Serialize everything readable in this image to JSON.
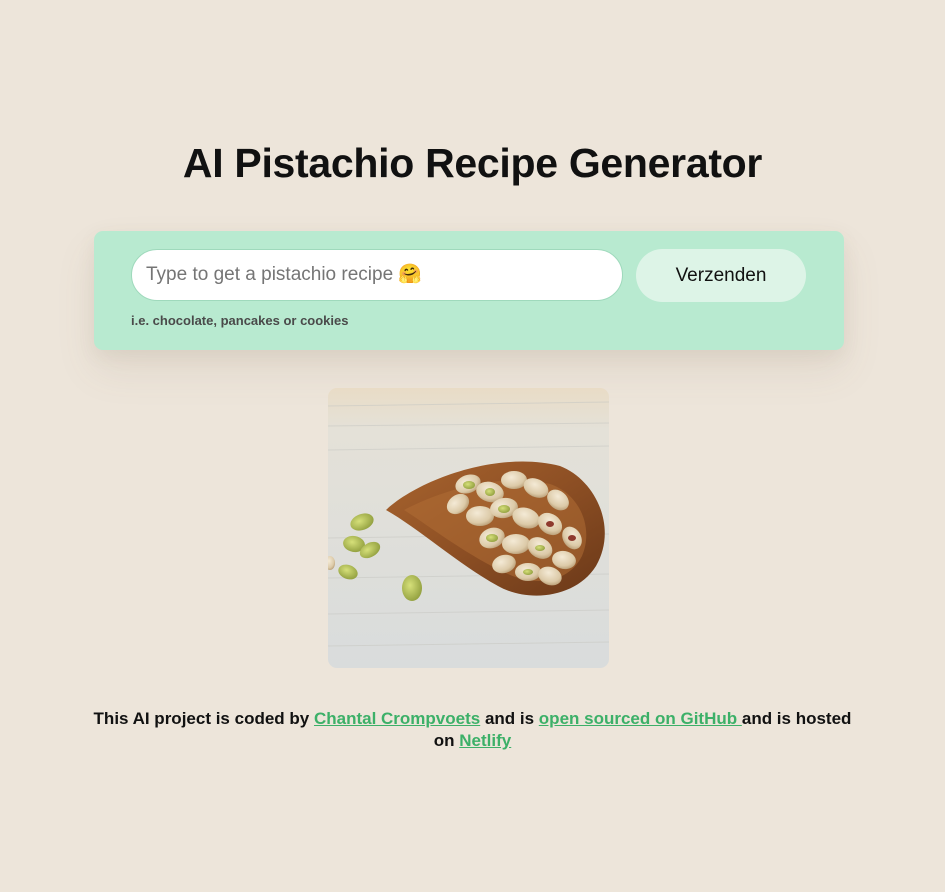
{
  "page": {
    "title": "AI Pistachio Recipe Generator"
  },
  "form": {
    "input_placeholder": "Type to get a pistachio recipe 🤗",
    "input_value": "",
    "submit_label": "Verzenden",
    "hint": "i.e. chocolate, pancakes or cookies"
  },
  "image": {
    "alt": "pistachios in a wooden scoop",
    "icon": "pistachio-photo"
  },
  "footer": {
    "text_before_author": "This AI project is coded by ",
    "author_link": "Chantal Crompvoets",
    "text_middle": " and is ",
    "github_link": "open sourced on GitHub ",
    "text_before_host": "and is hosted on ",
    "host_link": "Netlify"
  },
  "colors": {
    "background": "#ede5da",
    "card": "#b8ead0",
    "button": "#ddf4e7",
    "link": "#3cb068"
  }
}
